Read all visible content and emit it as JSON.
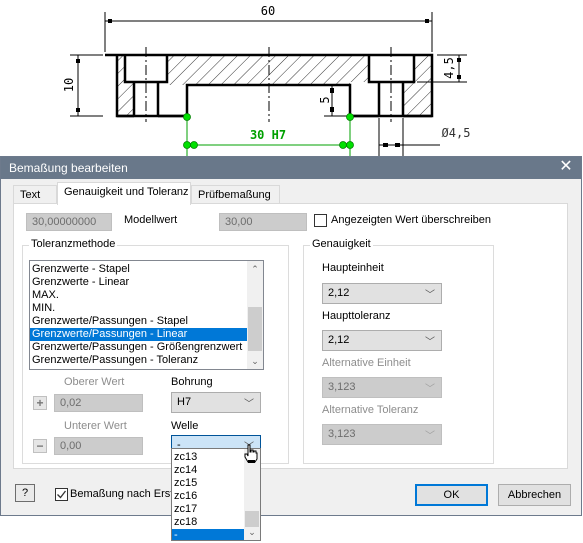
{
  "drawing": {
    "dim_overall_width": "60",
    "dim_height": "10",
    "dim_counterbore_depth": "4,5",
    "dim_slot_depth": "5",
    "dim_hole_diameter": "Ø4,5",
    "dim_selected": "30 H7",
    "colors": {
      "selected": "#00a000",
      "grip": "#00e000",
      "outline": "#000000"
    }
  },
  "dialog": {
    "title": "Bemaßung bearbeiten",
    "close_icon": "close-icon",
    "tabs": [
      {
        "label": "Text",
        "active": false
      },
      {
        "label": "Genauigkeit und Toleranz",
        "active": true
      },
      {
        "label": "Prüfbemaßung",
        "active": false
      }
    ],
    "model_value_field": "30,00000000",
    "model_value_label": "Modellwert",
    "displayed_value_field": "30,00",
    "override_checkbox": {
      "label": "Angezeigten Wert überschreiben",
      "checked": false
    },
    "tolerance_method": {
      "group_label": "Toleranzmethode",
      "items": [
        "Grenzwerte - Stapel",
        "Grenzwerte - Linear",
        "MAX.",
        "MIN.",
        "Grenzwerte/Passungen - Stapel",
        "Grenzwerte/Passungen - Linear",
        "Grenzwerte/Passungen - Größengrenzwert",
        "Grenzwerte/Passungen - Toleranz"
      ],
      "selected_index": 5
    },
    "upper_value": {
      "label": "Oberer Wert",
      "value": "0,02",
      "button_icon": "plus-icon"
    },
    "lower_value": {
      "label": "Unterer Wert",
      "value": "0,00",
      "button_icon": "minus-icon"
    },
    "hole": {
      "label": "Bohrung",
      "value": "H7"
    },
    "shaft": {
      "label": "Welle",
      "value": "-",
      "options_visible": [
        "zc13",
        "zc14",
        "zc15",
        "zc16",
        "zc17",
        "zc18",
        "-"
      ],
      "selected_index": 6
    },
    "precision": {
      "group_label": "Genauigkeit",
      "primary_unit": {
        "label": "Haupteinheit",
        "value": "2,12"
      },
      "primary_tolerance": {
        "label": "Haupttoleranz",
        "value": "2,12"
      },
      "alt_unit": {
        "label": "Alternative Einheit",
        "value": "3,123"
      },
      "alt_tolerance": {
        "label": "Alternative Toleranz",
        "value": "3,123"
      }
    },
    "help_button": "?",
    "edit_after_create_checkbox": {
      "label": "Bemaßung nach Erstellen bearbeiten",
      "visible_label": "Bemaßung nach Erste",
      "checked": true
    },
    "ok_label": "OK",
    "cancel_label": "Abbrechen"
  }
}
